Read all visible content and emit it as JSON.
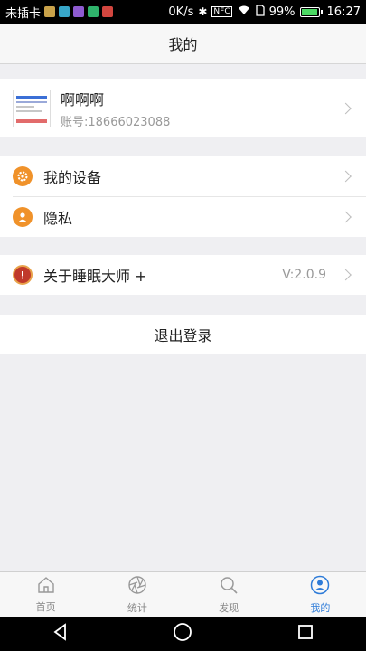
{
  "status_bar": {
    "carrier": "未插卡",
    "speed": "0K/s",
    "nfc": "NFC",
    "battery": "99%",
    "battery_level": 0.99,
    "time": "16:27"
  },
  "header": {
    "title": "我的"
  },
  "profile": {
    "name": "啊啊啊",
    "account": "账号:18666023088"
  },
  "menu": {
    "devices": {
      "label": "我的设备",
      "icon": "gear-icon",
      "color": "#f0922a"
    },
    "privacy": {
      "label": "隐私",
      "icon": "person-icon",
      "color": "#f0922a"
    },
    "about": {
      "label": "关于睡眠大师 +",
      "version": "V:2.0.9",
      "icon": "info-icon",
      "color": "#c0392b"
    }
  },
  "logout_label": "退出登录",
  "tabs": [
    {
      "label": "首页",
      "icon": "home-icon",
      "active": false
    },
    {
      "label": "统计",
      "icon": "aperture-icon",
      "active": false
    },
    {
      "label": "发现",
      "icon": "search-icon",
      "active": false
    },
    {
      "label": "我的",
      "icon": "person-icon",
      "active": true
    }
  ],
  "accent_color": "#2d7bd8"
}
